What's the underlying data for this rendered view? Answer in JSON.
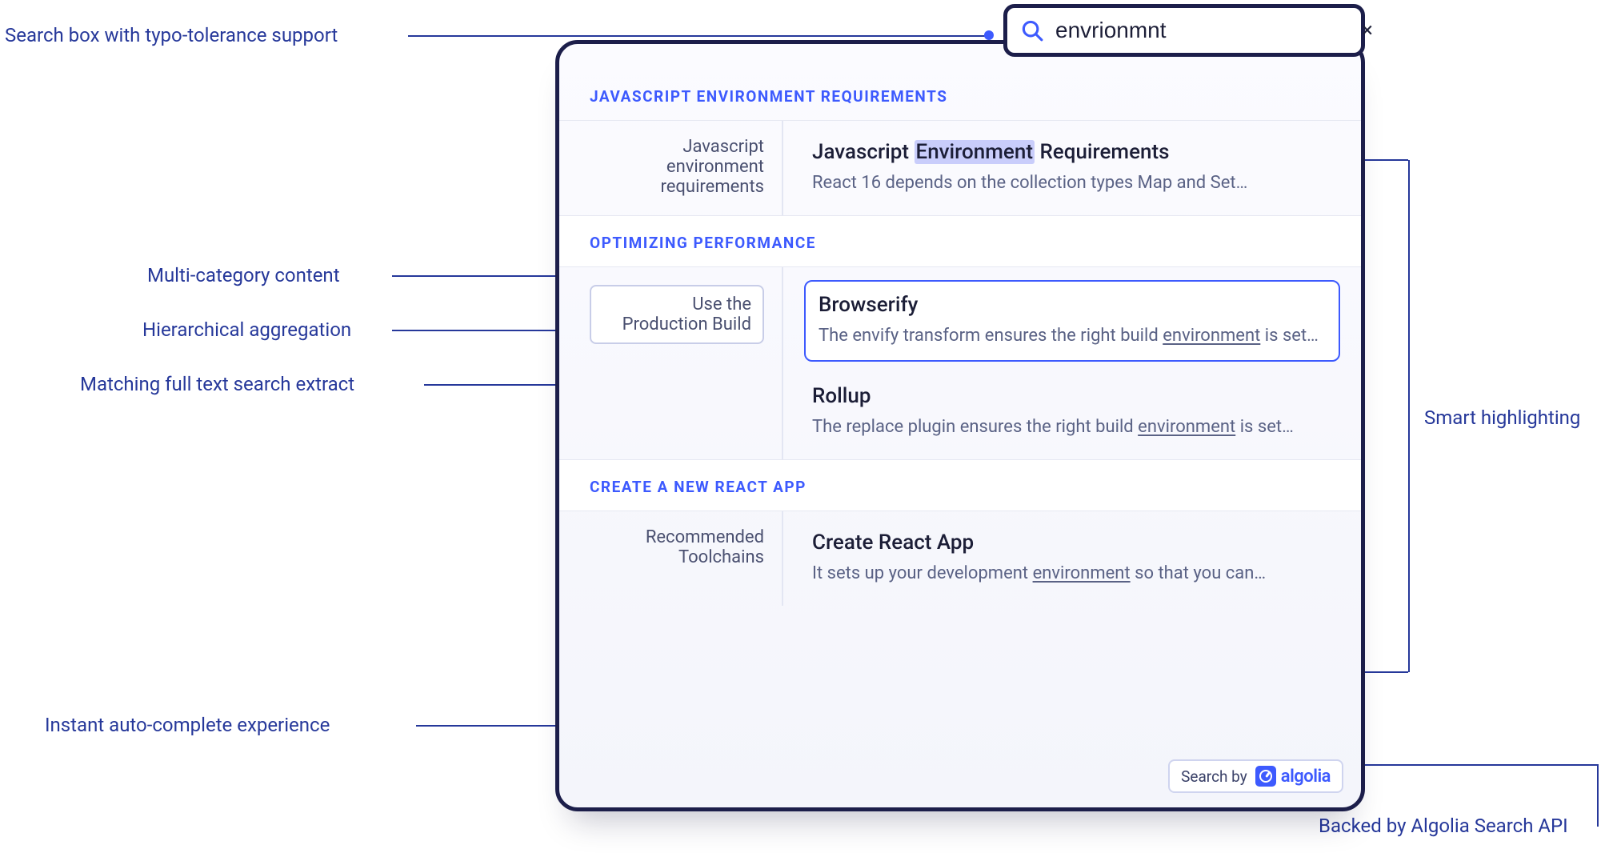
{
  "annotations": {
    "searchbox": "Search box with typo-tolerance support",
    "multicat": "Multi-category content",
    "hier": "Hierarchical aggregation",
    "fulltext": "Matching full text search extract",
    "autocomplete": "Instant auto-complete experience",
    "smarthl": "Smart highlighting",
    "backed": "Backed by Algolia Search API"
  },
  "search": {
    "value": "envrionmnt",
    "clear_label": "×"
  },
  "groups": [
    {
      "header": "JAVASCRIPT ENVIRONMENT REQUIREMENTS",
      "left_label": "Javascript environment requirements",
      "left_boxed": false,
      "hits": [
        {
          "boxed": false,
          "title_pre": "Javascript ",
          "title_hl": "Environment",
          "title_post": " Requirements",
          "snippet_pre": "React 16 depends on the collection types Map and Set…",
          "snippet_ul": "",
          "snippet_post": ""
        }
      ]
    },
    {
      "header": "OPTIMIZING PERFORMANCE",
      "left_label": "Use the Production Build",
      "left_boxed": true,
      "hits": [
        {
          "boxed": true,
          "title_pre": "Browserify",
          "title_hl": "",
          "title_post": "",
          "snippet_pre": "The envify transform ensures the right build ",
          "snippet_ul": "environment",
          "snippet_post": " is set…"
        },
        {
          "boxed": false,
          "title_pre": "Rollup",
          "title_hl": "",
          "title_post": "",
          "snippet_pre": "The replace plugin ensures the right build ",
          "snippet_ul": "environment",
          "snippet_post": " is set…"
        }
      ]
    },
    {
      "header": "CREATE A NEW REACT APP",
      "left_label": "Recommended Toolchains",
      "left_boxed": false,
      "hits": [
        {
          "boxed": false,
          "title_pre": "Create React App",
          "title_hl": "",
          "title_post": "",
          "snippet_pre": "It sets up your development ",
          "snippet_ul": "environment",
          "snippet_post": " so that you can…"
        }
      ]
    }
  ],
  "footer": {
    "searchby": "Search by",
    "brand": "algolia"
  }
}
